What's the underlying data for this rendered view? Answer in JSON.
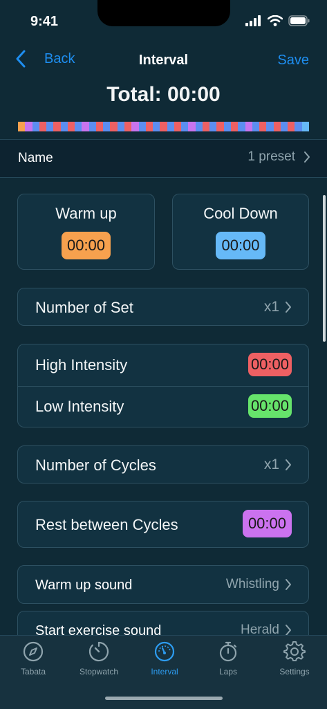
{
  "status_bar": {
    "time": "9:41"
  },
  "nav": {
    "back_label": "Back",
    "title": "Interval",
    "save_label": "Save"
  },
  "total": "Total: 00:00",
  "strip_colors": [
    "#f7a14e",
    "#c874ee",
    "#5c8ef0",
    "#ee6063",
    "#5c8ef0",
    "#ee6063",
    "#5c8ef0",
    "#ee6063",
    "#5c8ef0",
    "#c874ee",
    "#5c8ef0",
    "#ee6063",
    "#5c8ef0",
    "#ee6063",
    "#5c8ef0",
    "#ee6063",
    "#c874ee",
    "#5c8ef0",
    "#ee6063",
    "#5c8ef0",
    "#ee6063",
    "#5c8ef0",
    "#ee6063",
    "#5c8ef0",
    "#c874ee",
    "#5c8ef0",
    "#ee6063",
    "#5c8ef0",
    "#ee6063",
    "#5c8ef0",
    "#ee6063",
    "#5c8ef0",
    "#c874ee",
    "#5c8ef0",
    "#ee6063",
    "#5c8ef0",
    "#ee6063",
    "#5c8ef0",
    "#ee6063",
    "#5c8ef0",
    "#66b9f7"
  ],
  "name_row": {
    "label": "Name",
    "value": "1 preset"
  },
  "warm_up": {
    "label": "Warm up",
    "time": "00:00"
  },
  "cool_down": {
    "label": "Cool Down",
    "time": "00:00"
  },
  "number_of_set": {
    "label": "Number of Set",
    "value": "x1"
  },
  "high_intensity": {
    "label": "High Intensity",
    "time": "00:00"
  },
  "low_intensity": {
    "label": "Low Intensity",
    "time": "00:00"
  },
  "number_of_cycles": {
    "label": "Number of Cycles",
    "value": "x1"
  },
  "rest_between_cycles": {
    "label": "Rest between Cycles",
    "time": "00:00"
  },
  "warm_up_sound": {
    "label": "Warm up sound",
    "value": "Whistling"
  },
  "start_exercise_sound": {
    "label": "Start exercise sound",
    "value": "Herald"
  },
  "tabs": [
    {
      "label": "Tabata",
      "icon": "compass-icon"
    },
    {
      "label": "Stopwatch",
      "icon": "stopwatch-icon"
    },
    {
      "label": "Interval",
      "icon": "gauge-icon",
      "active": true
    },
    {
      "label": "Laps",
      "icon": "timer-icon"
    },
    {
      "label": "Settings",
      "icon": "gear-icon"
    }
  ],
  "colors": {
    "accent": "#1e8ef0",
    "background": "#0f2a36",
    "card": "#123241"
  }
}
